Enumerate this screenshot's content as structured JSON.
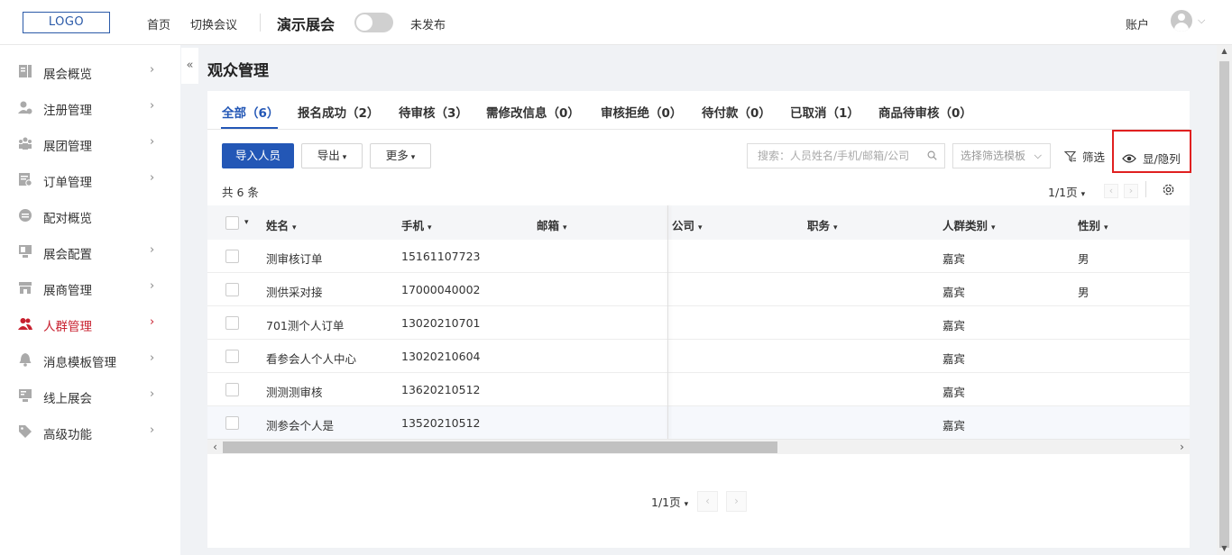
{
  "header": {
    "logo": "LOGO",
    "nav_home": "首页",
    "nav_switch": "切换会议",
    "expo_name": "演示展会",
    "publish_status": "未发布",
    "account": "账户"
  },
  "sidebar": {
    "collapse": "«",
    "items": [
      {
        "label": "展会概览",
        "icon": "overview-icon",
        "arrow": "›"
      },
      {
        "label": "注册管理",
        "icon": "registration-icon",
        "arrow": "›"
      },
      {
        "label": "展团管理",
        "icon": "delegation-icon",
        "arrow": "›"
      },
      {
        "label": "订单管理",
        "icon": "order-icon",
        "arrow": "›"
      },
      {
        "label": "配对概览",
        "icon": "matching-icon",
        "arrow": ""
      },
      {
        "label": "展会配置",
        "icon": "config-icon",
        "arrow": "›"
      },
      {
        "label": "展商管理",
        "icon": "exhibitor-icon",
        "arrow": "›"
      },
      {
        "label": "人群管理",
        "icon": "people-icon",
        "arrow": "›",
        "active": true
      },
      {
        "label": "消息模板管理",
        "icon": "bell-icon",
        "arrow": "›"
      },
      {
        "label": "线上展会",
        "icon": "online-icon",
        "arrow": "›"
      },
      {
        "label": "高级功能",
        "icon": "tag-icon",
        "arrow": "›"
      }
    ]
  },
  "main": {
    "title": "观众管理",
    "tabs": [
      {
        "label": "全部（6）"
      },
      {
        "label": "报名成功（2）"
      },
      {
        "label": "待审核（3）"
      },
      {
        "label": "需修改信息（0）"
      },
      {
        "label": "审核拒绝（0）"
      },
      {
        "label": "待付款（0）"
      },
      {
        "label": "已取消（1）"
      },
      {
        "label": "商品待审核（0）"
      }
    ],
    "toolbar": {
      "import": "导入人员",
      "export": "导出",
      "more": "更多",
      "search_placeholder": "搜索：人员姓名/手机/邮箱/公司",
      "template_placeholder": "选择筛选模板",
      "filter": "筛选",
      "toggle_columns": "显/隐列"
    },
    "total": "共 6 条",
    "page_indicator": "1/1页",
    "columns": [
      "姓名",
      "手机",
      "邮箱",
      "公司",
      "职务",
      "人群类别",
      "性别"
    ],
    "rows": [
      {
        "name": "测审核订单",
        "phone": "15161107723",
        "email": "",
        "company": "",
        "title": "",
        "category": "嘉宾",
        "gender": "男"
      },
      {
        "name": "测供采对接",
        "phone": "17000040002",
        "email": "",
        "company": "",
        "title": "",
        "category": "嘉宾",
        "gender": "男"
      },
      {
        "name": "701测个人订单",
        "phone": "13020210701",
        "email": "",
        "company": "",
        "title": "",
        "category": "嘉宾",
        "gender": ""
      },
      {
        "name": "看参会人个人中心",
        "phone": "13020210604",
        "email": "",
        "company": "",
        "title": "",
        "category": "嘉宾",
        "gender": ""
      },
      {
        "name": "测测测审核",
        "phone": "13620210512",
        "email": "",
        "company": "",
        "title": "",
        "category": "嘉宾",
        "gender": ""
      },
      {
        "name": "测参会个人是",
        "phone": "13520210512",
        "email": "",
        "company": "",
        "title": "",
        "category": "嘉宾",
        "gender": ""
      }
    ],
    "bottom_page_indicator": "1/1页"
  },
  "colors": {
    "primary": "#2357b6",
    "active_nav": "#c8202f",
    "highlight_border": "#e02020"
  }
}
